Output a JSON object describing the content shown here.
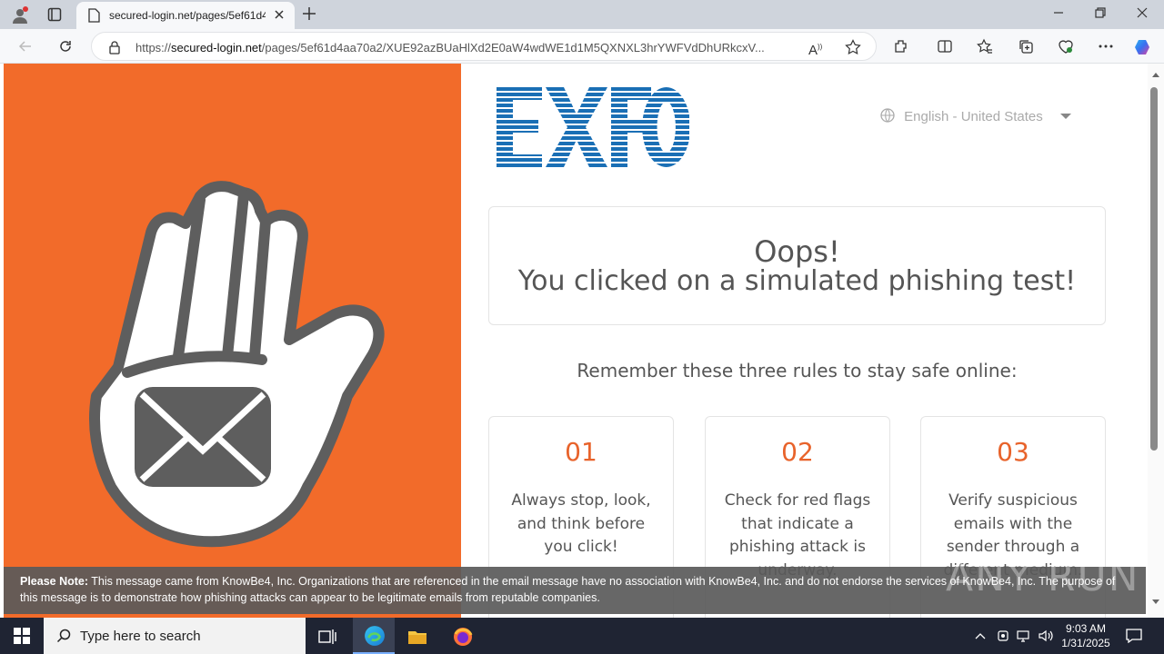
{
  "browser": {
    "tab_title": "secured-login.net/pages/5ef61d4",
    "url_prefix": "https://",
    "url_domain": "secured-login.net",
    "url_path": "/pages/5ef61d4aa70a2/XUE92azBUaHlXd2E0aW4wdWE1d1M5QXNXL3hrYWFVdDhURkcxV..."
  },
  "page": {
    "language": "English - United States",
    "oops_line1": "Oops!",
    "oops_line2": "You clicked on a simulated phishing test!",
    "rules_heading": "Remember these three rules to stay safe online:",
    "rules": [
      {
        "number": "01",
        "text": "Always stop, look, and think before you click!"
      },
      {
        "number": "02",
        "text": "Check for red flags that indicate a phishing attack is underway."
      },
      {
        "number": "03",
        "text": "Verify suspicious emails with the sender through a different medium."
      }
    ],
    "note_label": "Please Note:",
    "note_text": " This message came from KnowBe4, Inc. Organizations that are referenced in the email message have no association with KnowBe4, Inc. and do not endorse the services of KnowBe4, Inc. The purpose of this message is to demonstrate how phishing attacks can appear to be legitimate emails from reputable companies.",
    "watermark": "ANY RUN"
  },
  "taskbar": {
    "search_placeholder": "Type here to search",
    "time": "9:03 AM",
    "date": "1/31/2025"
  },
  "colors": {
    "accent_orange": "#f26b2a",
    "logo_blue": "#1a6fb5"
  },
  "icons": [
    "profile-icon",
    "tab-actions-icon",
    "page-icon",
    "close-icon",
    "new-tab-icon",
    "minimize-icon",
    "restore-icon",
    "back-icon",
    "refresh-icon",
    "lock-icon",
    "read-aloud-icon",
    "favorite-icon",
    "extensions-icon",
    "split-screen-icon",
    "favorites-icon",
    "collections-icon",
    "browser-essentials-icon",
    "more-icon",
    "copilot-icon",
    "globe-icon",
    "chevron-down-icon",
    "stop-hand-icon",
    "windows-start-icon",
    "search-icon",
    "task-view-icon",
    "edge-icon",
    "file-explorer-icon",
    "firefox-icon",
    "notification-icon"
  ]
}
